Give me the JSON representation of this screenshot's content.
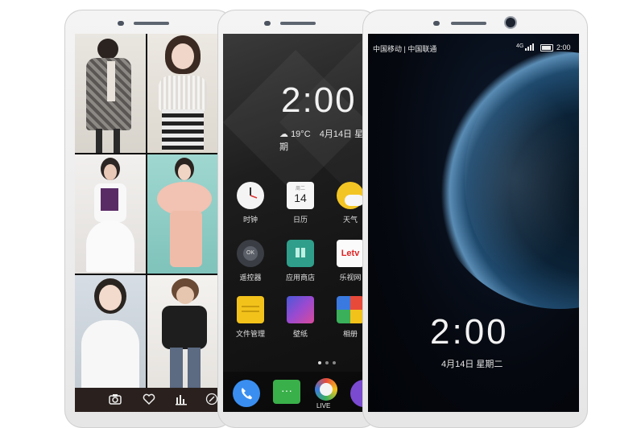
{
  "gallery": {
    "toolbar_icons": [
      "camera-icon",
      "heart-icon",
      "bars-icon",
      "brush-icon"
    ]
  },
  "home": {
    "clock": "2:00",
    "temperature": "19°C",
    "date": "4月14日 星期",
    "apps": [
      {
        "label": "时钟",
        "icon": "clock-icon"
      },
      {
        "label": "日历",
        "icon": "calendar-icon",
        "calendar_weekday": "周二",
        "calendar_day": "14"
      },
      {
        "label": "天气",
        "icon": "weather-icon"
      },
      {
        "label": "遥控器",
        "icon": "remote-icon",
        "badge": "OK"
      },
      {
        "label": "应用商店",
        "icon": "store-icon"
      },
      {
        "label": "乐视网",
        "icon": "letv-icon",
        "logo": "Letv"
      },
      {
        "label": "文件管理",
        "icon": "folder-icon"
      },
      {
        "label": "壁纸",
        "icon": "wallpaper-icon"
      },
      {
        "label": "相册",
        "icon": "album-icon"
      }
    ],
    "dock": [
      {
        "icon": "phone-icon"
      },
      {
        "icon": "messages-icon"
      },
      {
        "icon": "live-icon",
        "label": "LIVE"
      },
      {
        "icon": "music-icon"
      }
    ]
  },
  "lock": {
    "carriers": "中国移动 | 中国联通",
    "network": "4G",
    "status_time": "2:00",
    "clock": "2:00",
    "date": "4月14日  星期二"
  },
  "colors": {
    "letv_red": "#e02424",
    "store_green": "#2f9e8a",
    "folder_yellow": "#f2c21b"
  }
}
